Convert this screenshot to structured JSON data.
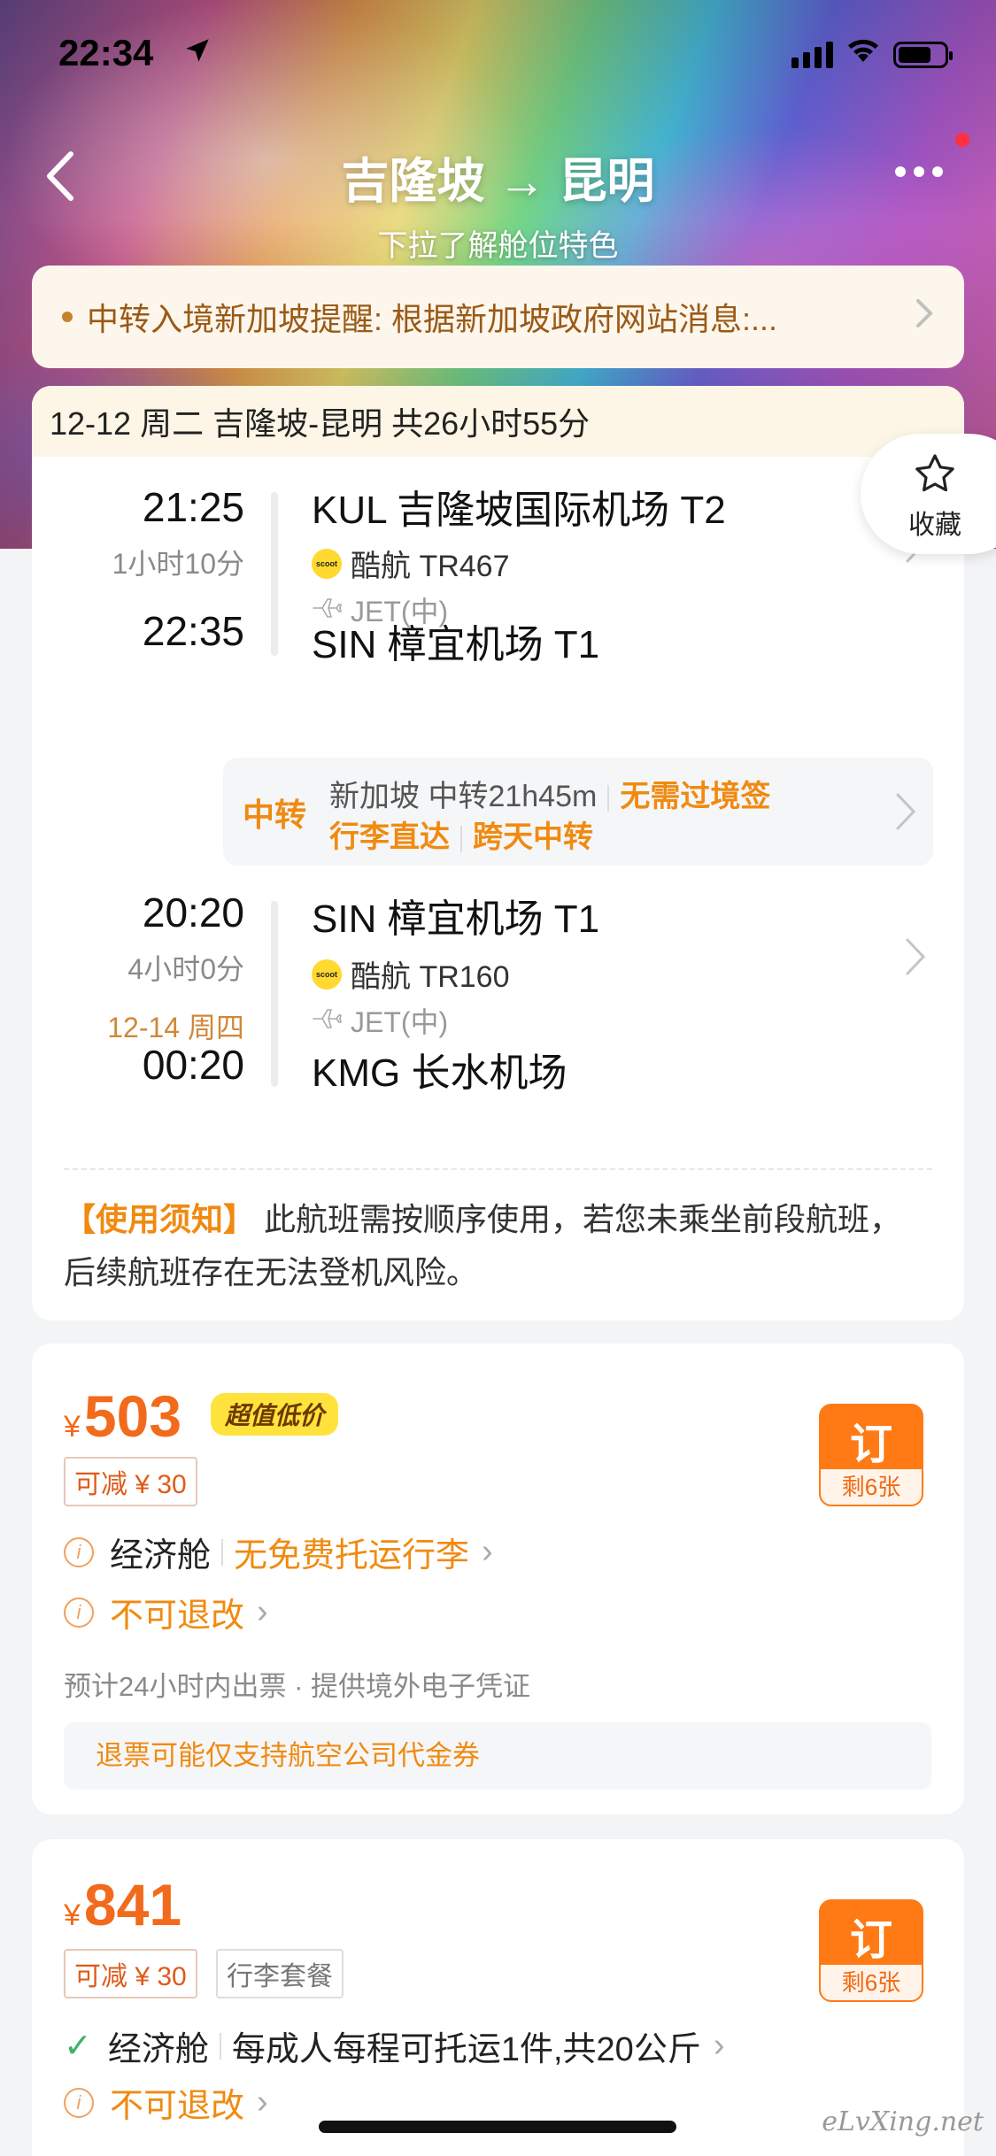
{
  "status_bar": {
    "time": "22:34"
  },
  "nav": {
    "title": "吉隆坡 → 昆明",
    "subtitle": "下拉了解舱位特色"
  },
  "notice": {
    "text": "中转入境新加坡提醒: 根据新加坡政府网站消息:..."
  },
  "favorite": {
    "label": "收藏"
  },
  "itinerary": {
    "summary": "12-12 周二 吉隆坡-昆明 共26小时55分",
    "segments": [
      {
        "dep_time": "21:25",
        "duration": "1小时10分",
        "arr_time": "22:35",
        "dep_airport": "KUL 吉隆坡国际机场 T2",
        "airline": "酷航 TR467",
        "aircraft": "JET(中)",
        "arr_airport": "SIN 樟宜机场 T1"
      },
      {
        "dep_time": "20:20",
        "duration": "4小时0分",
        "arr_date": "12-14 周四",
        "arr_time": "00:20",
        "dep_airport": "SIN 樟宜机场 T1",
        "airline": "酷航 TR160",
        "aircraft": "JET(中)",
        "arr_airport": "KMG 长水机场"
      }
    ],
    "transfer": {
      "tag": "中转",
      "city_duration": "新加坡 中转21h45m",
      "visa": "无需过境签",
      "baggage": "行李直达",
      "overnight": "跨天中转"
    },
    "usage_title": "【使用须知】",
    "usage_text": " 此航班需按顺序使用，若您未乘坐前段航班，后续航班存在无法登机风险。"
  },
  "fares": [
    {
      "currency": "¥",
      "price": "503",
      "badge": "超值低价",
      "discount": "可减 ¥ 30",
      "book_label": "订",
      "remaining": "剩6张",
      "cabin": "经济舱",
      "baggage": "无免费托运行李",
      "refund_policy": "不可退改",
      "note": "预计24小时内出票 · 提供境外电子凭证",
      "refund_note": "退票可能仅支持航空公司代金券"
    },
    {
      "currency": "¥",
      "price": "841",
      "discount": "可减 ¥ 30",
      "package": "行李套餐",
      "book_label": "订",
      "remaining": "剩6张",
      "cabin": "经济舱",
      "baggage": "每成人每程可托运1件,共20公斤",
      "refund_policy": "不可退改"
    }
  ],
  "watermark": "eLvXing.net",
  "colors": {
    "accent": "#f08a10",
    "price": "#f26a1b",
    "book": "#ff7a14",
    "badge": "#ffe23b"
  },
  "icons": [
    "location-arrow-icon",
    "signal-icon",
    "wifi-icon",
    "battery-icon",
    "back-icon",
    "more-icon",
    "star-icon",
    "chevron-right-icon",
    "scoot-logo-icon",
    "plane-icon",
    "info-icon",
    "check-icon"
  ]
}
